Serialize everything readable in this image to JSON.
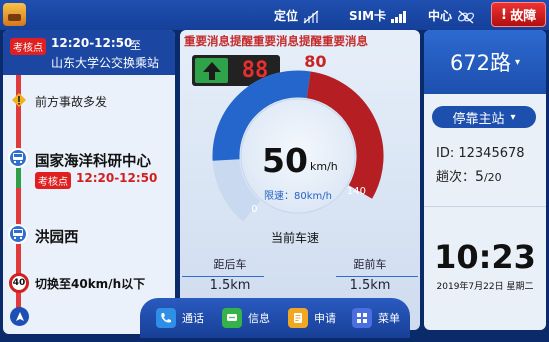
{
  "topbar": {
    "location_label": "定位",
    "sim_label": "SIM卡",
    "center_label": "中心",
    "fault_label": "故障"
  },
  "left": {
    "exam_tag": "考核点",
    "head_time": "12:20-12:50",
    "head_to": "至",
    "head_station": "山东大学公交换乘站",
    "accident_text": "前方事故多发",
    "station1": "国家海洋科研中心",
    "station1_tag": "考核点",
    "station1_time": "12:20-12:50",
    "station2": "洪园西",
    "speed_limit_value": "40",
    "speed_switch_text": "切换至40km/h以下"
  },
  "center": {
    "ticker": "重要消息提醒重要消息提醒重要消息",
    "signal_number": "88",
    "speed": "50",
    "speed_unit": "km/h",
    "limit_text": "限速：80km/h",
    "gauge_min": "0",
    "gauge_max": "140",
    "limit_mark": "80",
    "current_speed_label": "当前车速",
    "rear_label": "距后车",
    "rear_value": "1.5km",
    "front_label": "距前车",
    "front_value": "1.5km"
  },
  "right": {
    "route": "672路",
    "stop_status": "停靠主站",
    "id_line": "ID:  12345678",
    "trips_label": "趟次：",
    "trips_current": "5",
    "trips_total": "/20",
    "time": "10:23",
    "date": "2019年7月22日  星期二"
  },
  "dock": {
    "call": "通话",
    "message": "信息",
    "apply": "申请",
    "menu": "菜单"
  },
  "colors": {
    "primary_blue": "#1d4fae",
    "alert_red": "#d12020",
    "gauge_red": "#b51f23",
    "signal_green": "#2ea34a"
  },
  "gauge": {
    "speed_value": 50,
    "limit_value": 80,
    "max_value": 140
  }
}
